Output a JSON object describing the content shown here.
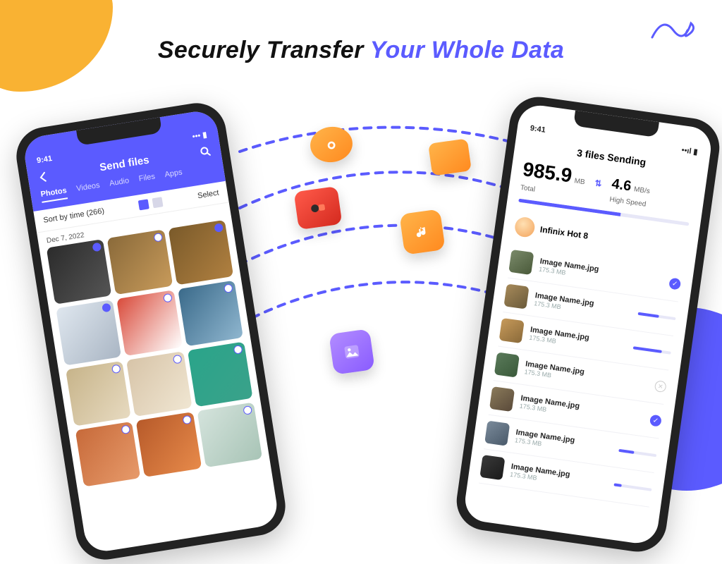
{
  "headline": {
    "part1": "Securely Transfer ",
    "part2": "Your Whole Data"
  },
  "phone_left": {
    "status_time": "9:41",
    "title": "Send files",
    "tabs": [
      "Photos",
      "Videos",
      "Audio",
      "Files",
      "Apps"
    ],
    "sort_label": "Sort by time (266)",
    "select_label": "Select",
    "date_group": "Dec 7, 2022",
    "thumbs": [
      {
        "c1": "#2b2b2b",
        "c2": "#555",
        "selected": true
      },
      {
        "c1": "#8a6a3a",
        "c2": "#c79a5a",
        "selected": false
      },
      {
        "c1": "#7a5a2a",
        "c2": "#b08040",
        "selected": true
      },
      {
        "c1": "#dfe7ef",
        "c2": "#aab6c4",
        "selected": true
      },
      {
        "c1": "#d94a3a",
        "c2": "#ffffff",
        "selected": false
      },
      {
        "c1": "#3a6a8a",
        "c2": "#8fb6cf",
        "selected": false
      },
      {
        "c1": "#c7b48a",
        "c2": "#e7dac0",
        "selected": false
      },
      {
        "c1": "#d7c4a8",
        "c2": "#f0e6d2",
        "selected": false
      },
      {
        "c1": "#2aa48a",
        "c2": "#3aa28a",
        "selected": false
      },
      {
        "c1": "#c76a3a",
        "c2": "#e79a6a",
        "selected": false
      },
      {
        "c1": "#b75a2a",
        "c2": "#e78a4a",
        "selected": false
      },
      {
        "c1": "#d4e3dc",
        "c2": "#a8c4b6",
        "selected": false
      }
    ]
  },
  "phone_right": {
    "status_time": "9:41",
    "title": "3 files Sending",
    "total_value": "985.9",
    "total_unit": "MB",
    "total_sub": "Total",
    "speed_value": "4.6",
    "speed_unit": "MB/s",
    "speed_sub": "High Speed",
    "device": "Infinix Hot 8",
    "items": [
      {
        "name": "Image Name.jpg",
        "size": "175.3 MB",
        "status": "done",
        "progress": 100,
        "c1": "#7a8a6a",
        "c2": "#4a5a3a"
      },
      {
        "name": "Image Name.jpg",
        "size": "175.3 MB",
        "status": "progress",
        "progress": 55,
        "c1": "#a78a5a",
        "c2": "#6a5a3a"
      },
      {
        "name": "Image Name.jpg",
        "size": "175.3 MB",
        "status": "progress",
        "progress": 75,
        "c1": "#c79a5a",
        "c2": "#8a6a3a"
      },
      {
        "name": "Image Name.jpg",
        "size": "175.3 MB",
        "status": "cancel",
        "progress": 0,
        "c1": "#5a7a5a",
        "c2": "#3a5a3a"
      },
      {
        "name": "Image Name.jpg",
        "size": "175.3 MB",
        "status": "done",
        "progress": 100,
        "c1": "#8a7a5a",
        "c2": "#5a4a3a"
      },
      {
        "name": "Image Name.jpg",
        "size": "175.3 MB",
        "status": "progress",
        "progress": 40,
        "c1": "#7a8a9a",
        "c2": "#4a5a6a"
      },
      {
        "name": "Image Name.jpg",
        "size": "175.3 MB",
        "status": "progress",
        "progress": 20,
        "c1": "#3a3a3a",
        "c2": "#1a1a1a"
      }
    ]
  },
  "floating_icons": [
    "camera",
    "folder",
    "video",
    "music",
    "image"
  ]
}
